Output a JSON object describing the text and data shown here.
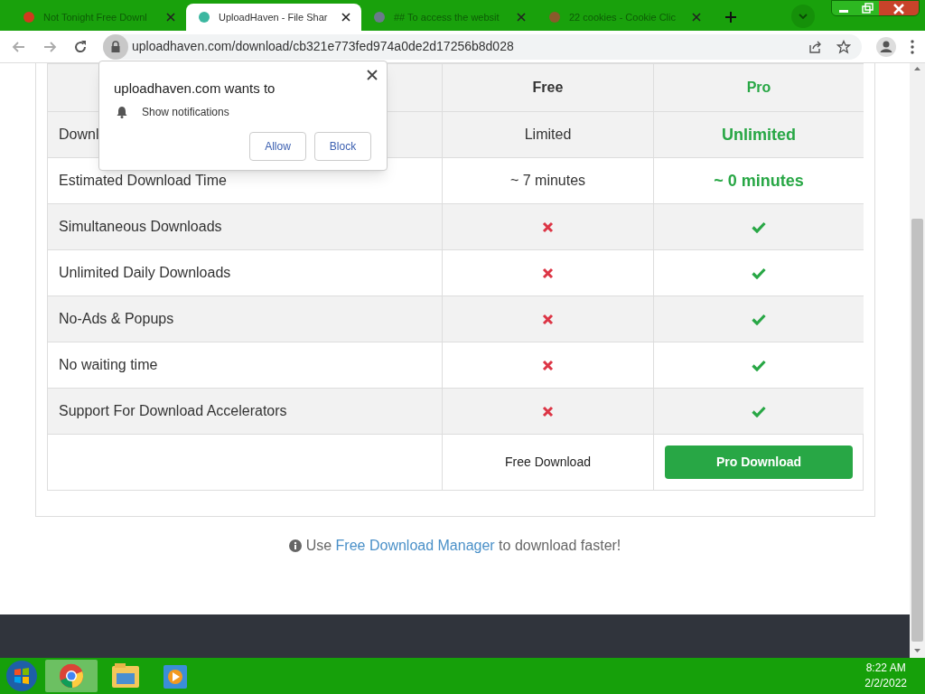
{
  "tabs": [
    {
      "title": "Not Tonight Free Downl",
      "selected": false
    },
    {
      "title": "UploadHaven - File Shar",
      "selected": true
    },
    {
      "title": "## To access the websit",
      "selected": false
    },
    {
      "title": "22 cookies - Cookie Clic",
      "selected": false
    }
  ],
  "address_bar": {
    "url": "uploadhaven.com/download/cb321e773fed974a0de2d17256b8d028"
  },
  "permission_popup": {
    "title": "uploadhaven.com wants to",
    "permission": "Show notifications",
    "buttons": [
      "Allow",
      "Block"
    ]
  },
  "table": {
    "columns": [
      "Free",
      "Pro"
    ],
    "rows": [
      {
        "kind": "text",
        "label": "Downl",
        "free": "Limited",
        "pro": "Unlimited"
      },
      {
        "kind": "text",
        "label": "Estimated Download Time",
        "free": "~ 7 minutes",
        "pro": "~ 0 minutes"
      },
      {
        "kind": "feature",
        "label": "Simultaneous Downloads",
        "free_available": false,
        "pro_available": true
      },
      {
        "kind": "feature",
        "label": "Unlimited Daily Downloads",
        "free_available": false,
        "pro_available": true
      },
      {
        "kind": "feature",
        "label": "No-Ads & Popups",
        "free_available": false,
        "pro_available": true
      },
      {
        "kind": "feature",
        "label": "No waiting time",
        "free_available": false,
        "pro_available": true
      },
      {
        "kind": "feature",
        "label": "Support For Download Accelerators",
        "free_available": false,
        "pro_available": true
      }
    ],
    "free_button": "Free Download",
    "pro_button": "Pro Download"
  },
  "tip": {
    "before": "Use",
    "link": "Free Download Manager",
    "after": "to download faster!"
  },
  "taskbar": {
    "time": "8:22 AM",
    "date": "2/2/2022"
  }
}
